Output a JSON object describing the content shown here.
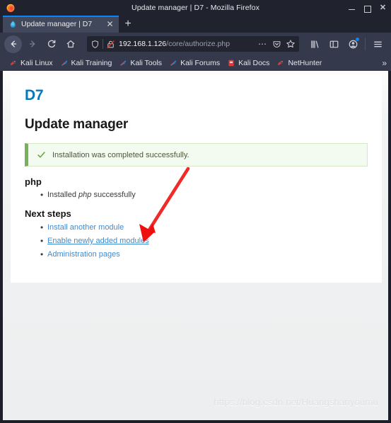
{
  "window": {
    "title": "Update manager | D7 - Mozilla Firefox",
    "minimize_label": "",
    "maximize_label": "",
    "close_label": "✕"
  },
  "tabs": [
    {
      "label": "Update manager | D7",
      "favicon": "drupal-icon",
      "close_label": "✕"
    }
  ],
  "newtab": {
    "label": "+"
  },
  "toolbar": {
    "back_label": "←",
    "forward_label": "→",
    "reload_label": "⟳",
    "home_label": "⌂",
    "url_host": "192.168.1.126",
    "url_path": "/core/authorize.php",
    "url_full": "192.168.1.126/core/authorize.php",
    "page_actions_label": "⋯",
    "pocket_label": "pocket-icon",
    "bookmark_star_label": "☆",
    "library_label": "library-icon",
    "sidebar_label": "sidebar-icon",
    "account_label": "account-icon",
    "menu_label": "☰"
  },
  "bookmarks": {
    "items": [
      {
        "label": "Kali Linux",
        "icon": "kali-dragon-red-icon"
      },
      {
        "label": "Kali Training",
        "icon": "kali-dragon-blue-icon"
      },
      {
        "label": "Kali Tools",
        "icon": "kali-dragon-blue-icon"
      },
      {
        "label": "Kali Forums",
        "icon": "kali-dragon-blue-icon"
      },
      {
        "label": "Kali Docs",
        "icon": "kali-book-red-icon"
      },
      {
        "label": "NetHunter",
        "icon": "kali-dragon-red-icon"
      }
    ],
    "overflow_label": "»"
  },
  "page": {
    "brand": "D7",
    "title": "Update manager",
    "alert": {
      "icon": "check-icon",
      "text": "Installation was completed successfully.",
      "accent_color": "#77b259",
      "background_color": "#f3faef"
    },
    "sections": [
      {
        "heading": "php",
        "items": [
          {
            "prefix": "Installed ",
            "emphasis": "php",
            "suffix": " successfully"
          }
        ]
      }
    ],
    "next_steps": {
      "heading": "Next steps",
      "links": [
        {
          "label": "Install another module",
          "underlined": false
        },
        {
          "label": "Enable newly added modules",
          "underlined": true
        },
        {
          "label": "Administration pages",
          "underlined": false
        }
      ],
      "link_color": "#3c8bd4"
    },
    "annotation": {
      "type": "red-arrow",
      "color": "#f01a1a",
      "points_at": "Enable newly added modules"
    },
    "watermark": "https://blog.csdn.net/Huangshanyoumu"
  }
}
